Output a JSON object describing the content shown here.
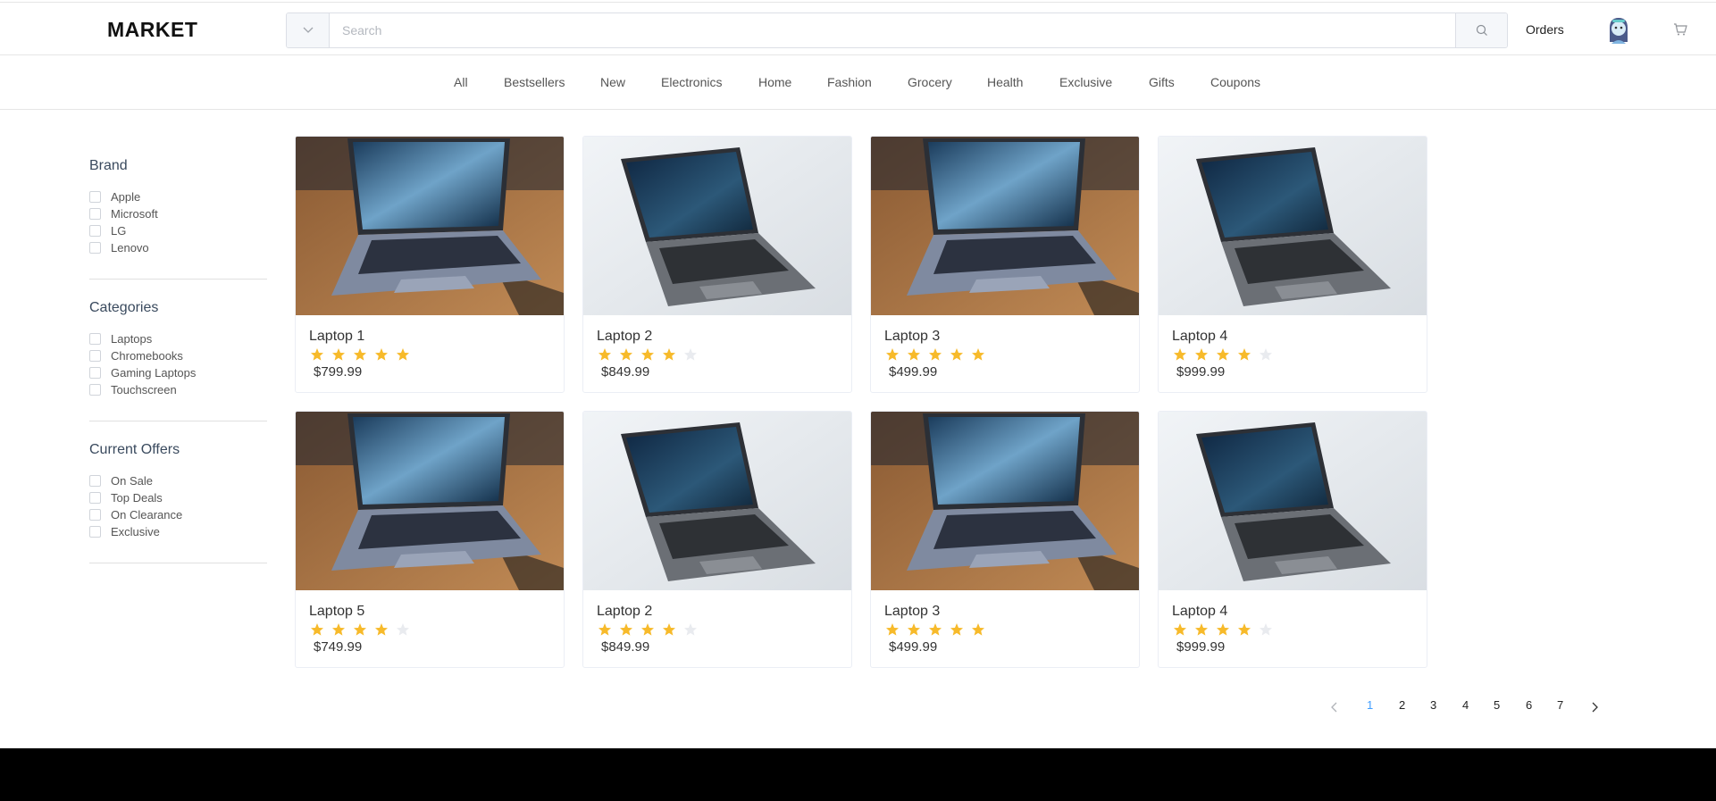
{
  "header": {
    "logo": "MARKET",
    "search_placeholder": "Search",
    "orders_label": "Orders",
    "icons": {
      "dropdown": "chevron-down-icon",
      "search": "search-icon",
      "avatar": "avatar",
      "cart": "cart-icon"
    }
  },
  "nav": {
    "items": [
      "All",
      "Bestsellers",
      "New",
      "Electronics",
      "Home",
      "Fashion",
      "Grocery",
      "Health",
      "Exclusive",
      "Gifts",
      "Coupons"
    ]
  },
  "filters": {
    "brand": {
      "title": "Brand",
      "options": [
        "Apple",
        "Microsoft",
        "LG",
        "Lenovo"
      ]
    },
    "categories": {
      "title": "Categories",
      "options": [
        "Laptops",
        "Chromebooks",
        "Gaming Laptops",
        "Touchscreen"
      ]
    },
    "offers": {
      "title": "Current Offers",
      "options": [
        "On Sale",
        "Top Deals",
        "On Clearance",
        "Exclusive"
      ]
    }
  },
  "products": [
    {
      "name": "Laptop 1",
      "price": "$799.99",
      "rating": 5,
      "image": "wood-laptop"
    },
    {
      "name": "Laptop 2",
      "price": "$849.99",
      "rating": 4,
      "image": "white-laptop"
    },
    {
      "name": "Laptop 3",
      "price": "$499.99",
      "rating": 5,
      "image": "wood-laptop"
    },
    {
      "name": "Laptop 4",
      "price": "$999.99",
      "rating": 4,
      "image": "white-laptop"
    },
    {
      "name": "Laptop 5",
      "price": "$749.99",
      "rating": 4,
      "image": "wood-laptop"
    },
    {
      "name": "Laptop 2",
      "price": "$849.99",
      "rating": 4,
      "image": "white-laptop"
    },
    {
      "name": "Laptop 3",
      "price": "$499.99",
      "rating": 5,
      "image": "wood-laptop"
    },
    {
      "name": "Laptop 4",
      "price": "$999.99",
      "rating": 4,
      "image": "white-laptop"
    }
  ],
  "pagination": {
    "pages": [
      "1",
      "2",
      "3",
      "4",
      "5",
      "6",
      "7"
    ],
    "current": "1"
  },
  "colors": {
    "star": "#f7ba2a",
    "star_empty": "#e9ebef",
    "accent": "#409eff",
    "footer": "#000000"
  }
}
